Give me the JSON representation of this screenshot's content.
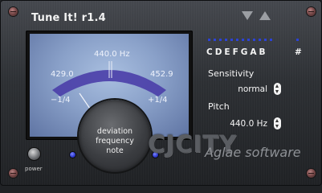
{
  "window": {
    "title": "Tune It! r1.4"
  },
  "meter": {
    "center_freq": "440.0 Hz",
    "left_freq": "429.0",
    "right_freq": "452.9",
    "left_tick": "−1/4",
    "right_tick": "+1/4",
    "hub_lines": [
      "deviation",
      "frequency",
      "note"
    ]
  },
  "notes": {
    "letters": "CDEFGAB",
    "sharp": "#"
  },
  "sensitivity": {
    "label": "Sensitivity",
    "value": "normal"
  },
  "pitch": {
    "label": "Pitch",
    "value": "440.0 Hz"
  },
  "footer": {
    "power_label": "power",
    "brand": "Aglae software",
    "logo_text": "CJCITY"
  },
  "colors": {
    "meter_bg": "#8aa1c9",
    "led": "#2a35c9",
    "arc": "#4a3ea9"
  }
}
